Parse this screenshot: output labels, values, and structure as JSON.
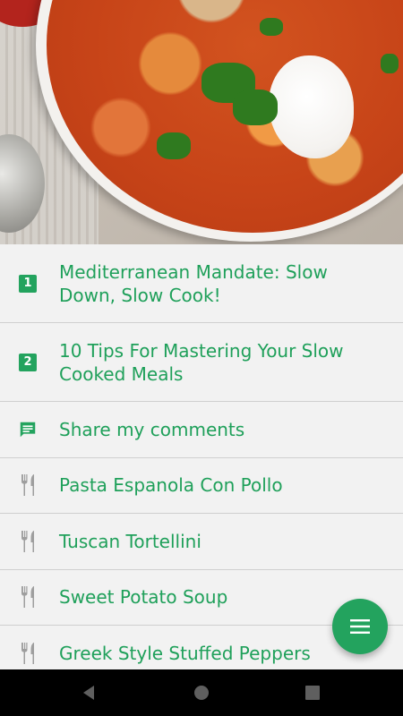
{
  "hero": {
    "image_icon": "soup-photo"
  },
  "list": {
    "items": [
      {
        "number": "1",
        "label": "Mediterranean Mandate: Slow Down, Slow Cook!",
        "icon": "number-badge"
      },
      {
        "number": "2",
        "label": "10 Tips For Mastering Your Slow Cooked Meals",
        "icon": "number-badge"
      },
      {
        "label": "Share my comments",
        "icon": "comment-icon"
      },
      {
        "label": "Pasta Espanola Con Pollo",
        "icon": "fork-knife-icon"
      },
      {
        "label": "Tuscan Tortellini",
        "icon": "fork-knife-icon"
      },
      {
        "label": "Sweet Potato Soup",
        "icon": "fork-knife-icon"
      },
      {
        "label": "Greek Style Stuffed Peppers",
        "icon": "fork-knife-icon"
      }
    ]
  },
  "fab": {
    "icon": "menu-icon"
  },
  "navbar": {
    "back_icon": "back-icon",
    "home_icon": "home-icon",
    "recents_icon": "recents-icon"
  },
  "colors": {
    "accent": "#23a35e",
    "text_green": "#1fa05a",
    "list_bg": "#f2f2f2",
    "divider": "#cfcfcf",
    "icon_gray": "#9e9e9e"
  }
}
